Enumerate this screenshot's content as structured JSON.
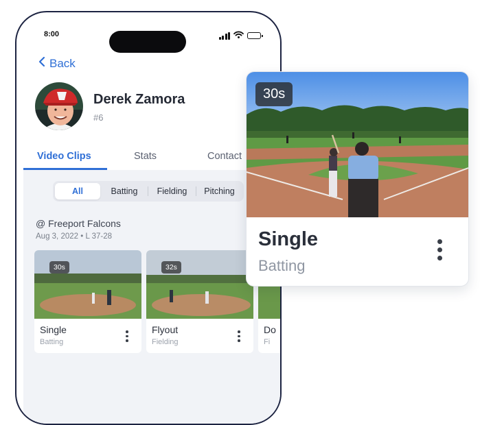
{
  "status_bar": {
    "time": "8:00"
  },
  "nav": {
    "back_label": "Back"
  },
  "player": {
    "name": "Derek Zamora",
    "number": "#6"
  },
  "tabs": [
    {
      "label": "Video Clips",
      "active": true
    },
    {
      "label": "Stats",
      "active": false
    },
    {
      "label": "Contact",
      "active": false
    }
  ],
  "filters": [
    {
      "label": "All",
      "active": true
    },
    {
      "label": "Batting",
      "active": false
    },
    {
      "label": "Fielding",
      "active": false
    },
    {
      "label": "Pitching",
      "active": false
    }
  ],
  "game": {
    "title": "@ Freeport Falcons",
    "meta": "Aug 3, 2022 • L 37-28"
  },
  "clips": [
    {
      "duration": "30s",
      "title": "Single",
      "category": "Batting"
    },
    {
      "duration": "32s",
      "title": "Flyout",
      "category": "Fielding"
    },
    {
      "duration": "",
      "title": "Do",
      "category": "Fi"
    }
  ],
  "featured_clip": {
    "duration": "30s",
    "title": "Single",
    "category": "Batting"
  },
  "colors": {
    "accent": "#2f6fd6",
    "phone_frame": "#1c2341",
    "content_background": "#f1f3f7"
  },
  "icons": {
    "back": "chevron-left-icon",
    "signal": "signal-icon",
    "wifi": "wifi-icon",
    "battery": "battery-icon",
    "more": "more-vertical-icon",
    "next": "chevron-right-icon"
  }
}
